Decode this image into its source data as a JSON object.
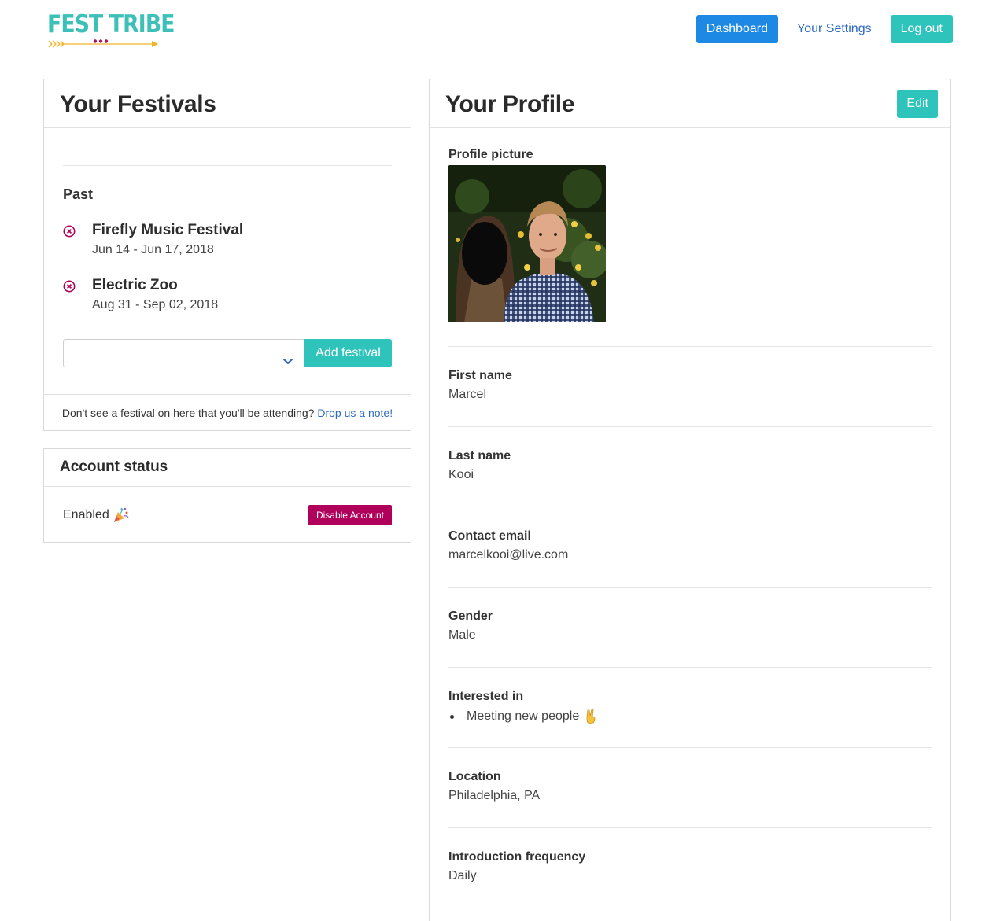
{
  "header": {
    "logo_text": "FEST TRIBE",
    "nav": {
      "dashboard_label": "Dashboard",
      "settings_label": "Your Settings",
      "logout_label": "Log out"
    }
  },
  "festivals": {
    "title": "Your Festivals",
    "past_label": "Past",
    "items": [
      {
        "name": "Firefly Music Festival",
        "dates": "Jun 14 - Jun 17, 2018"
      },
      {
        "name": "Electric Zoo",
        "dates": "Aug 31 - Sep 02, 2018"
      }
    ],
    "select": {
      "value": ""
    },
    "add_button_label": "Add festival",
    "footer_text": "Don't see a festival on here that you'll be attending?",
    "footer_link": "Drop us a note!"
  },
  "account": {
    "title": "Account status",
    "status": "Enabled",
    "disable_label": "Disable Account"
  },
  "profile": {
    "title": "Your Profile",
    "edit_label": "Edit",
    "picture_label": "Profile picture",
    "fields": [
      {
        "label": "First name",
        "value": "Marcel"
      },
      {
        "label": "Last name",
        "value": "Kooi"
      },
      {
        "label": "Contact email",
        "value": "marcelkooi@live.com"
      },
      {
        "label": "Gender",
        "value": "Male"
      }
    ],
    "interested_in": {
      "label": "Interested in",
      "items": [
        "Meeting new people"
      ]
    },
    "location": {
      "label": "Location",
      "value": "Philadelphia, PA"
    },
    "frequency": {
      "label": "Introduction frequency",
      "value": "Daily"
    }
  },
  "colors": {
    "teal": "#2ec4bb",
    "blue": "#1e88e5",
    "link": "#2e6ac0",
    "danger": "#b0005c"
  },
  "icons": [
    "remove-circle-icon",
    "chevron-down-icon",
    "party-popper-icon",
    "victory-hand-icon"
  ]
}
